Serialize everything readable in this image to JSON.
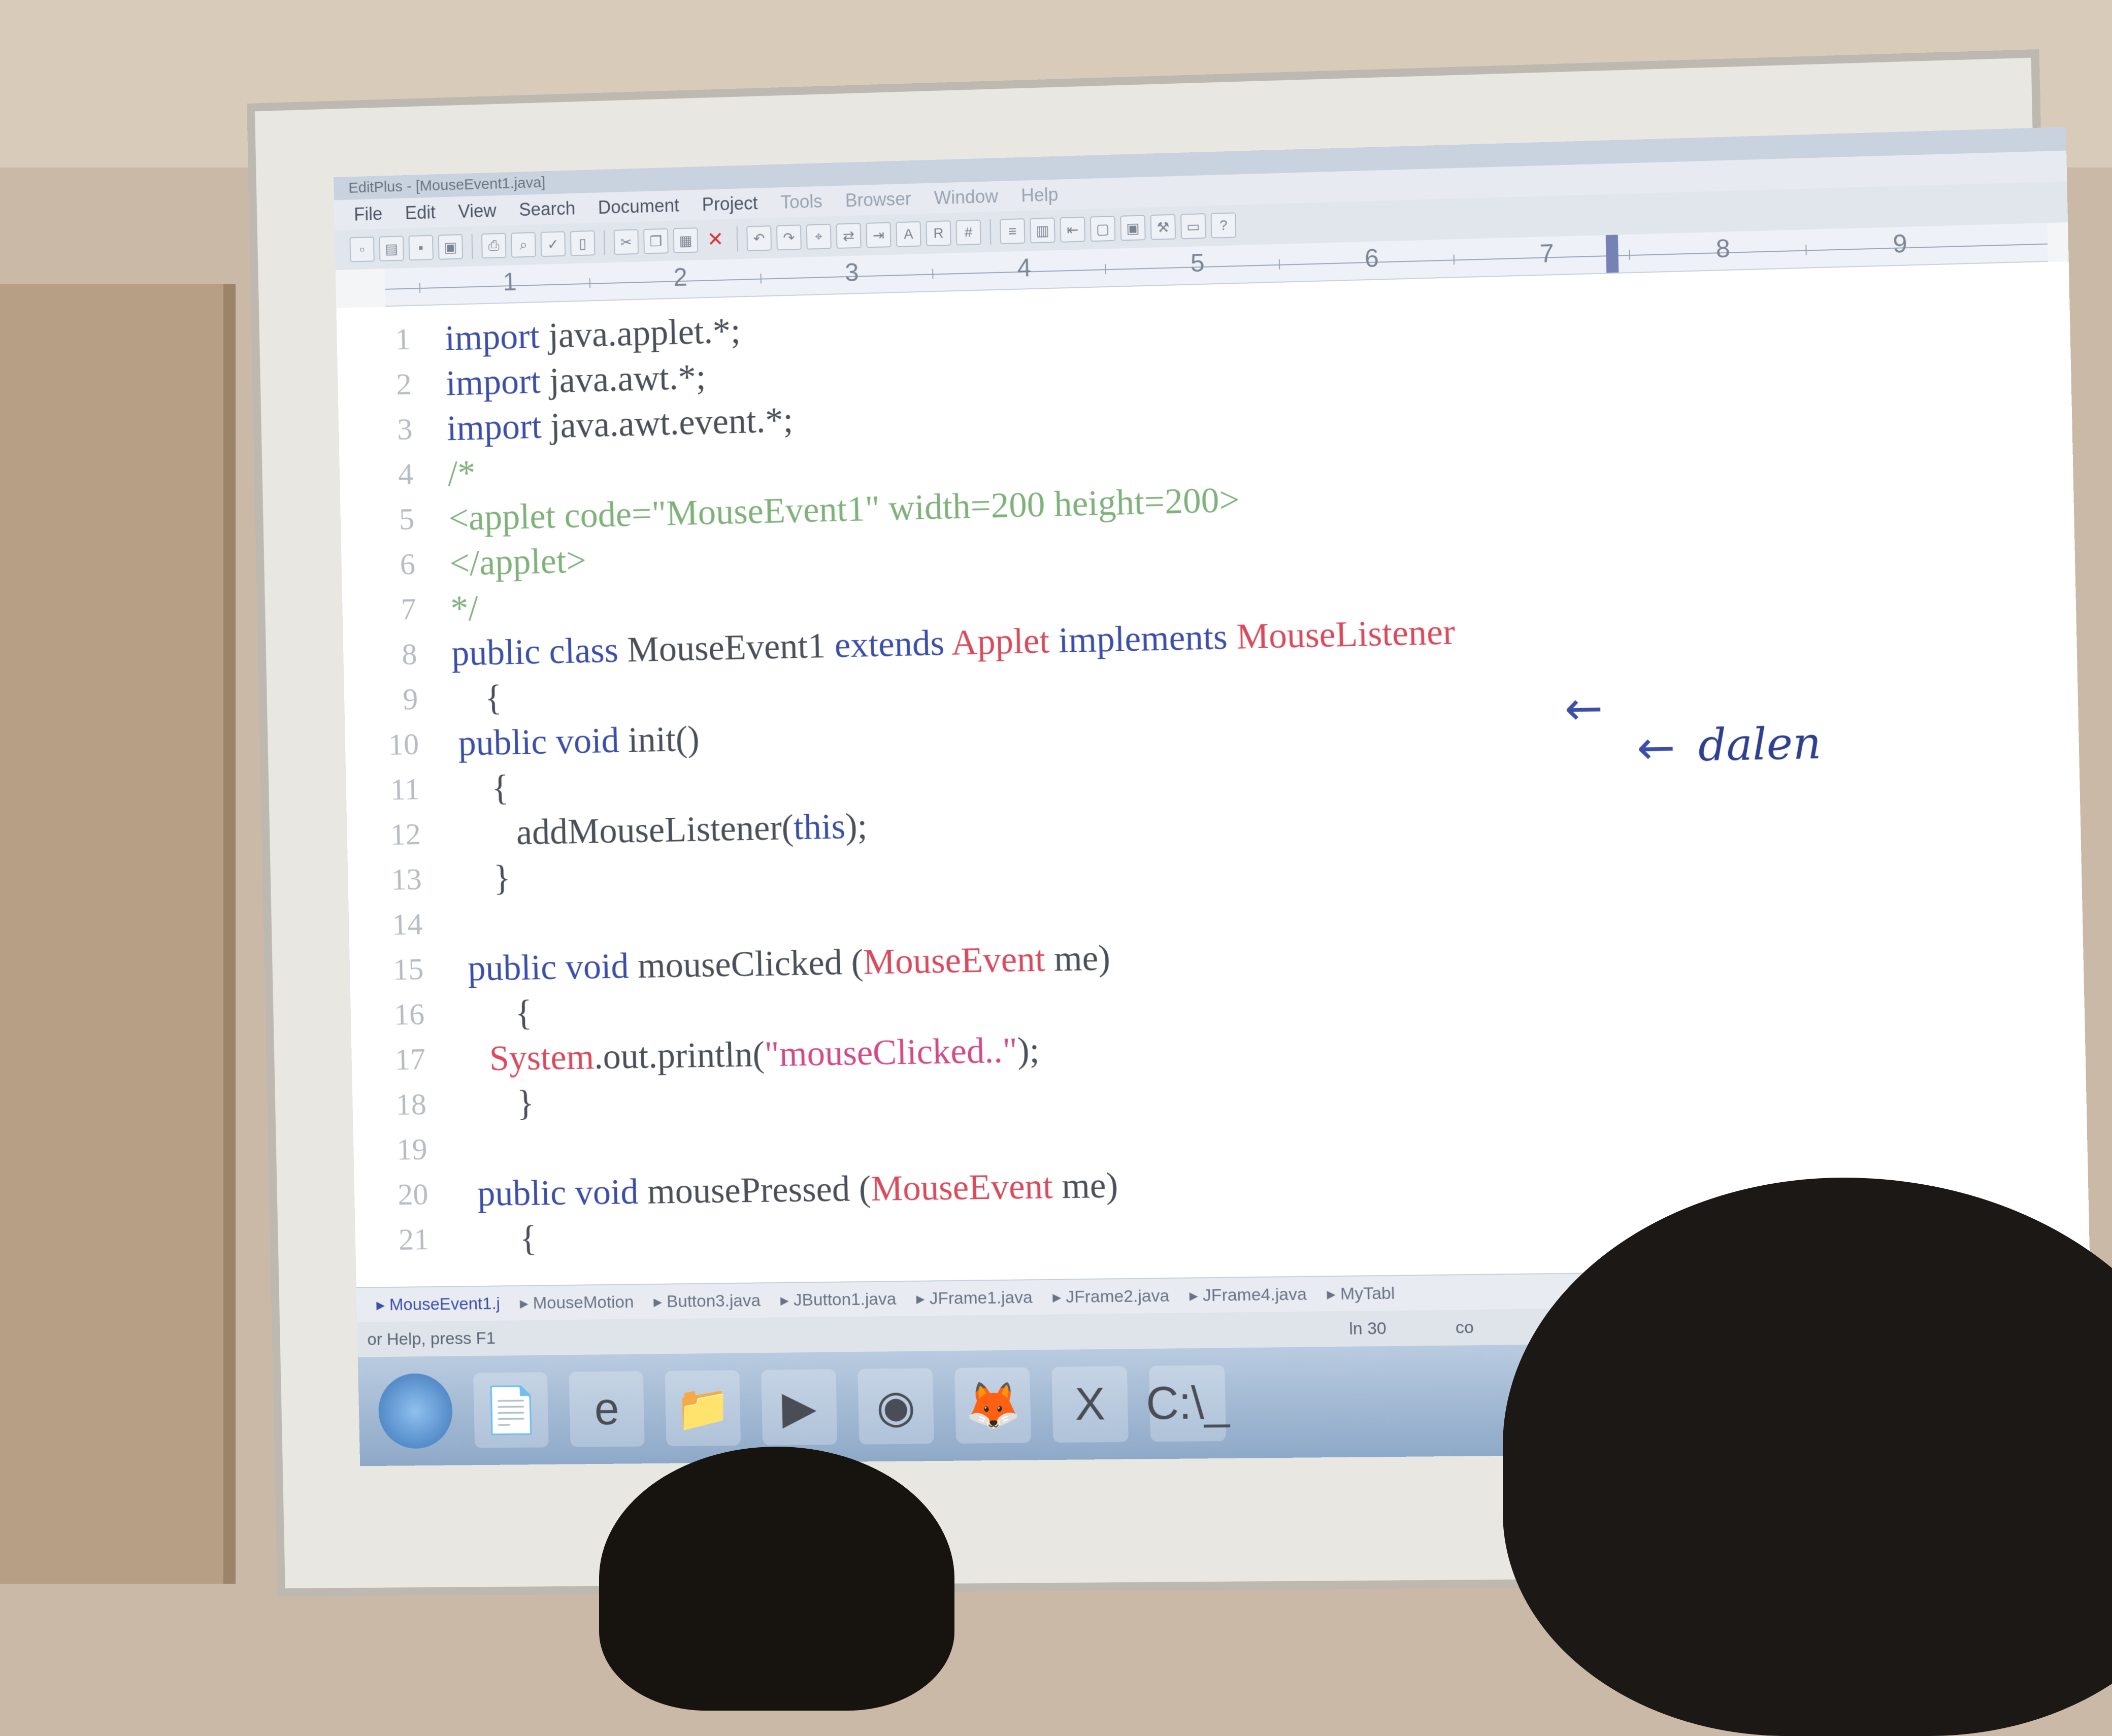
{
  "window": {
    "title": "EditPlus - [MouseEvent1.java]"
  },
  "menu": [
    "File",
    "Edit",
    "View",
    "Search",
    "Document",
    "Project",
    "Tools",
    "Browser",
    "Window",
    "Help"
  ],
  "ruler": [
    "1",
    "2",
    "3",
    "4",
    "5",
    "6",
    "7",
    "8",
    "9"
  ],
  "code_lines": [
    {
      "n": "1",
      "t": [
        [
          "kw",
          "import"
        ],
        [
          "p",
          " java.applet.*;"
        ]
      ]
    },
    {
      "n": "2",
      "t": [
        [
          "kw",
          "import"
        ],
        [
          "p",
          " java.awt.*;"
        ]
      ]
    },
    {
      "n": "3",
      "t": [
        [
          "kw",
          "import"
        ],
        [
          "p",
          " java.awt.event.*;"
        ]
      ]
    },
    {
      "n": "4",
      "t": [
        [
          "cmt",
          "/*"
        ]
      ]
    },
    {
      "n": "5",
      "t": [
        [
          "cmt",
          "<applet code=\"MouseEvent1\" width=200 height=200>"
        ]
      ]
    },
    {
      "n": "6",
      "t": [
        [
          "cmt",
          "</applet>"
        ]
      ]
    },
    {
      "n": "7",
      "t": [
        [
          "cmt",
          "*/"
        ]
      ]
    },
    {
      "n": "8",
      "t": [
        [
          "kw",
          "public class"
        ],
        [
          "p",
          " MouseEvent1 "
        ],
        [
          "kw",
          "extends"
        ],
        [
          "p",
          " "
        ],
        [
          "cls",
          "Applet"
        ],
        [
          "p",
          " "
        ],
        [
          "kw",
          "implements"
        ],
        [
          "p",
          " "
        ],
        [
          "cls",
          "MouseListener"
        ]
      ]
    },
    {
      "n": "9",
      "t": [
        [
          "p",
          "  {"
        ]
      ]
    },
    {
      "n": "10",
      "t": [
        [
          "kw",
          "public void"
        ],
        [
          "p",
          " init()"
        ]
      ]
    },
    {
      "n": "11",
      "t": [
        [
          "p",
          "  {"
        ]
      ]
    },
    {
      "n": "12",
      "t": [
        [
          "p",
          "   addMouseListener("
        ],
        [
          "kw",
          "this"
        ],
        [
          "p",
          ");"
        ]
      ]
    },
    {
      "n": "13",
      "t": [
        [
          "p",
          "  }"
        ]
      ]
    },
    {
      "n": "14",
      "t": []
    },
    {
      "n": "15",
      "t": [
        [
          "kw",
          "public void"
        ],
        [
          "p",
          " mouseClicked ("
        ],
        [
          "cls",
          "MouseEvent"
        ],
        [
          "p",
          " me)"
        ]
      ]
    },
    {
      "n": "16",
      "t": [
        [
          "p",
          "   {"
        ]
      ]
    },
    {
      "n": "17",
      "t": [
        [
          "cls",
          "System"
        ],
        [
          "p",
          ".out.println("
        ],
        [
          "str",
          "\"mouseClicked..\""
        ],
        [
          "p",
          ");"
        ]
      ]
    },
    {
      "n": "18",
      "t": [
        [
          "p",
          "   }"
        ]
      ]
    },
    {
      "n": "19",
      "t": []
    },
    {
      "n": "20",
      "t": [
        [
          "kw",
          "public void"
        ],
        [
          "p",
          " mousePressed ("
        ],
        [
          "cls",
          "MouseEvent"
        ],
        [
          "p",
          " me)"
        ]
      ]
    },
    {
      "n": "21",
      "t": [
        [
          "p",
          "   {"
        ]
      ]
    }
  ],
  "annotations": {
    "arrow1": "←",
    "arrow2": "←",
    "handwritten": "dalen"
  },
  "file_tabs": [
    "MouseEvent1.j",
    "MouseMotion",
    "Button3.java",
    "JButton1.java",
    "JFrame1.java",
    "JFrame2.java",
    "JFrame4.java",
    "MyTabl"
  ],
  "status": {
    "help": "or Help, press F1",
    "line": "ln 30",
    "col": "co"
  },
  "taskbar": [
    {
      "name": "windows-start-icon",
      "glyph": ""
    },
    {
      "name": "editplus-icon",
      "glyph": "📄"
    },
    {
      "name": "internet-explorer-icon",
      "glyph": "e"
    },
    {
      "name": "file-explorer-icon",
      "glyph": "📁"
    },
    {
      "name": "media-player-icon",
      "glyph": "▶"
    },
    {
      "name": "chrome-icon",
      "glyph": "◉"
    },
    {
      "name": "firefox-icon",
      "glyph": "🦊"
    },
    {
      "name": "excel-icon",
      "glyph": "X"
    },
    {
      "name": "command-prompt-icon",
      "glyph": "C:\\_"
    }
  ]
}
